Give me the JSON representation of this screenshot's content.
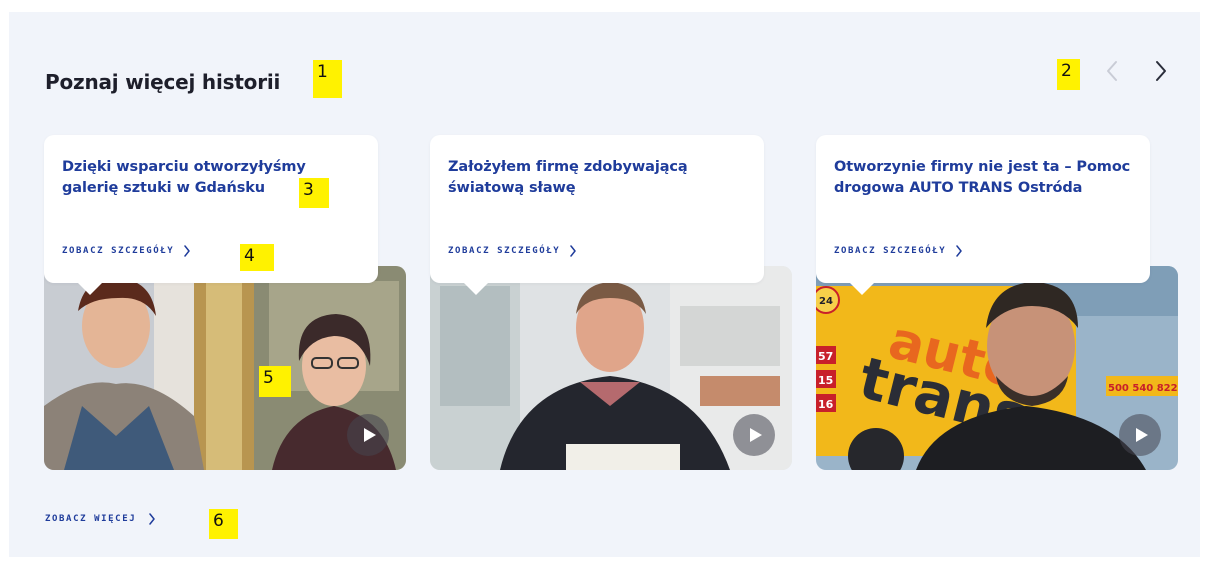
{
  "section": {
    "title": "Poznaj więcej historii",
    "see_more_label": "ZOBACZ WIĘCEJ"
  },
  "carousel": {
    "prev_icon": "chevron-left-icon",
    "next_icon": "chevron-right-icon",
    "prev_color": "#c9ccd6",
    "next_color": "#2a2d3a"
  },
  "cards": [
    {
      "title": "Dzięki wsparciu otworzyłyśmy galerię sztuki w Gdańsku",
      "link_label": "ZOBACZ SZCZEGÓŁY"
    },
    {
      "title": "Założyłem firmę zdobywającą światową sławę",
      "link_label": "ZOBACZ SZCZEGÓŁY"
    },
    {
      "title": "Otworzynie firmy nie jest ta – Pomoc drogowa AUTO TRANS Ostróda",
      "link_label": "ZOBACZ SZCZEGÓŁY"
    }
  ],
  "truck": {
    "brand_line1": "auto",
    "brand_line2": "trans",
    "badge": "24",
    "numbers": [
      "57",
      "15",
      "16"
    ],
    "phone": "500 540 822"
  },
  "markers": [
    "1",
    "2",
    "3",
    "4",
    "5",
    "6"
  ],
  "colors": {
    "background": "#f1f4fa",
    "link": "#1f3c9b",
    "heading": "#1e1f2b",
    "marker": "#fff200"
  }
}
